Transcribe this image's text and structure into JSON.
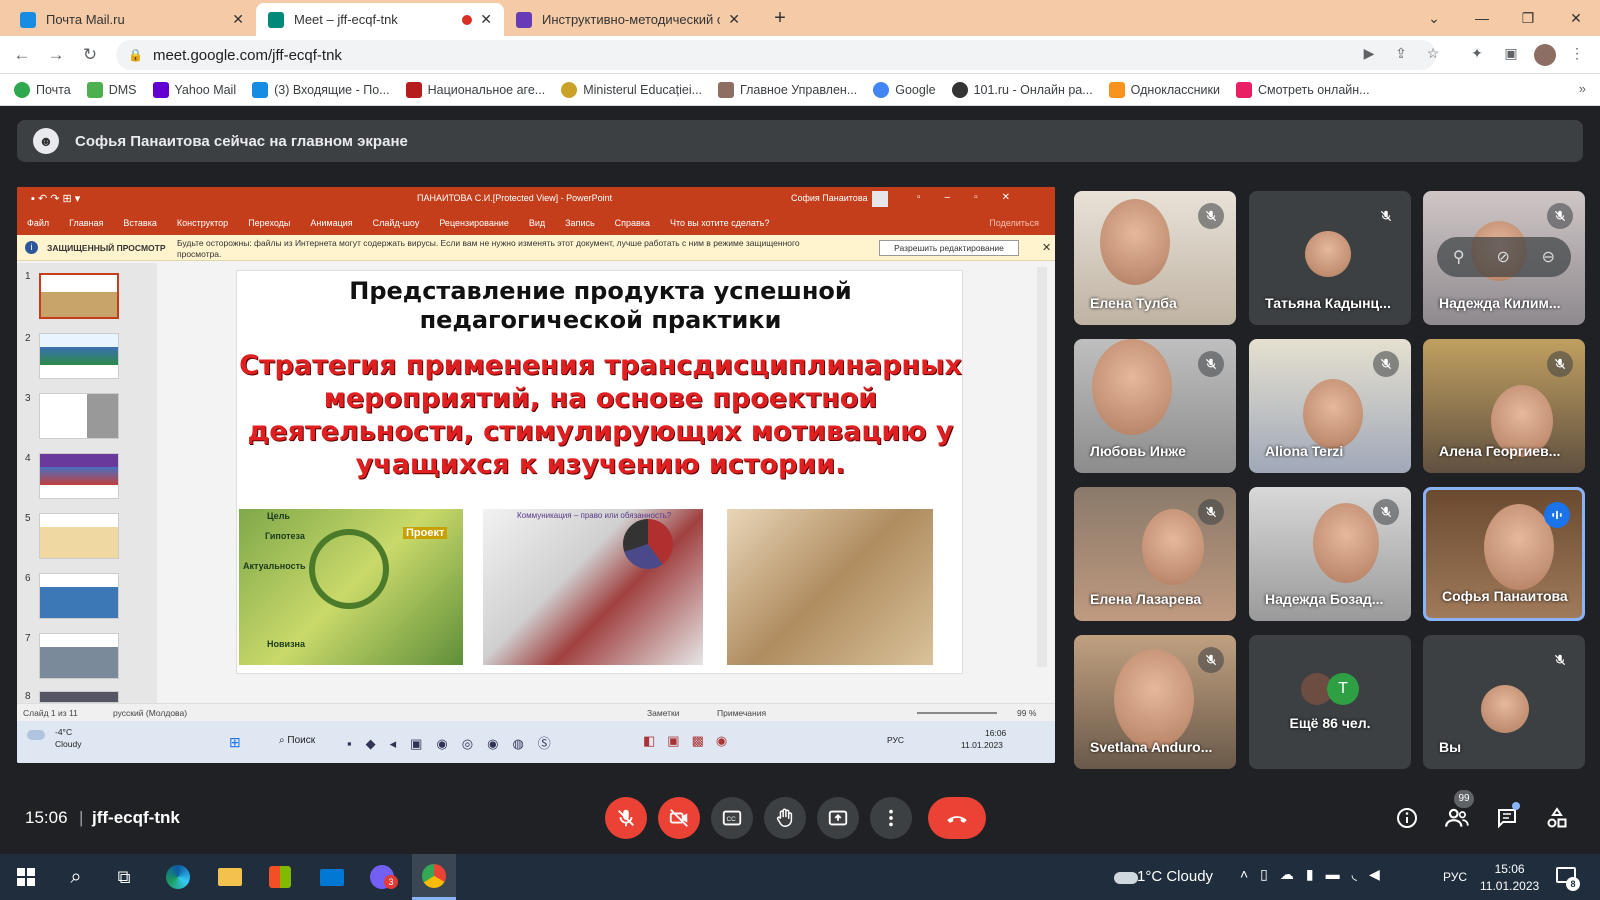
{
  "browser": {
    "tabs": [
      {
        "title": "Почта Mail.ru",
        "favicon_color": "#168de2"
      },
      {
        "title": "Meet – jff-ecqf-tnk",
        "favicon_color": "#00897b"
      },
      {
        "title": "Инструктивно-методический се",
        "favicon_color": "#673ab7"
      }
    ],
    "url": "meet.google.com/jff-ecqf-tnk",
    "bookmarks": [
      {
        "label": "Почта",
        "color": "#2fa84f"
      },
      {
        "label": "DMS",
        "color": "#4caf50"
      },
      {
        "label": "Yahoo Mail",
        "color": "#6001d2"
      },
      {
        "label": "(3) Входящие - По...",
        "color": "#168de2"
      },
      {
        "label": "Национальное аге...",
        "color": "#b71c1c"
      },
      {
        "label": "Ministerul Educației...",
        "color": "#c9a227"
      },
      {
        "label": "Главное Управлен...",
        "color": "#8d6e63"
      },
      {
        "label": "Google",
        "color": "#4285f4"
      },
      {
        "label": "101.ru - Онлайн ра...",
        "color": "#333333"
      },
      {
        "label": "Одноклассники",
        "color": "#f7931e"
      },
      {
        "label": "Смотреть онлайн...",
        "color": "#e91e63"
      }
    ]
  },
  "meet": {
    "banner_text": "Софья Панаитова сейчас на главном экране",
    "time": "15:06",
    "meeting_code": "jff-ecqf-tnk",
    "participants_badge": "99",
    "participants": [
      {
        "name": "Елена Тулба",
        "muted": true
      },
      {
        "name": "Татьяна Кадынц...",
        "muted": true
      },
      {
        "name": "Надежда Килим...",
        "muted": true
      },
      {
        "name": "Любовь Инже",
        "muted": true
      },
      {
        "name": "Aliona Terzi",
        "muted": true
      },
      {
        "name": "Алена Георгиев...",
        "muted": true
      },
      {
        "name": "Елена Лазарева",
        "muted": true
      },
      {
        "name": "Надежда Бозад...",
        "muted": true
      },
      {
        "name": "Софья Панаитова",
        "muted": false
      },
      {
        "name": "Svetlana Anduro...",
        "muted": true
      },
      {
        "name": "Ещё 86 чел.",
        "muted": false
      },
      {
        "name": "Вы",
        "muted": true
      }
    ],
    "more_avatar_letter": "T"
  },
  "presentation": {
    "window_title": "ПАНАИТОВА С.И.[Protected View] - PowerPoint",
    "user": "София Панаитова",
    "menu": [
      "Файл",
      "Главная",
      "Вставка",
      "Конструктор",
      "Переходы",
      "Анимация",
      "Слайд-шоу",
      "Рецензирование",
      "Вид",
      "Запись",
      "Справка",
      "Что вы хотите сделать?"
    ],
    "share_label": "Поделиться",
    "protected_label": "ЗАЩИЩЕННЫЙ ПРОСМОТР",
    "protected_msg": "Будьте осторожны: файлы из Интернета могут содержать вирусы. Если вам не нужно изменять этот документ, лучше работать с ним в режиме защищенного просмотра.",
    "enable_edit": "Разрешить редактирование",
    "slide_title": "Представление продукта успешной педагогической практики",
    "slide_subtitle": "Стратегия применения трансдисциплинарных мероприятий, на основе проектной деятельности, стимулирующих мотивацию у учащихся к изучению истории.",
    "slide_numbers": [
      "1",
      "2",
      "3",
      "4",
      "5",
      "6",
      "7",
      "8"
    ],
    "status_slide": "Слайд 1 из 11",
    "status_lang": "русский (Молдова)",
    "notes": "Заметки",
    "comments": "Примечания",
    "zoom": "99 %",
    "inner_taskbar": {
      "temp": "-4°C",
      "weather": "Cloudy",
      "search": "Поиск",
      "lang": "РУС",
      "time": "16:06",
      "date": "11.01.2023"
    },
    "collage": {
      "cell1_title": "Цель",
      "cell1_hypothesis": "Гипотеза",
      "cell1_relevance": "Актуальность",
      "cell1_novelty": "Новизна",
      "cell1_project": "Проект",
      "cell2_title": "Коммуникация – право или обязанность?"
    }
  },
  "taskbar": {
    "weather": "1°C  Cloudy",
    "lang": "РУС",
    "time": "15:06",
    "date": "11.01.2023",
    "notifications": "8",
    "viber_badge": "3"
  }
}
